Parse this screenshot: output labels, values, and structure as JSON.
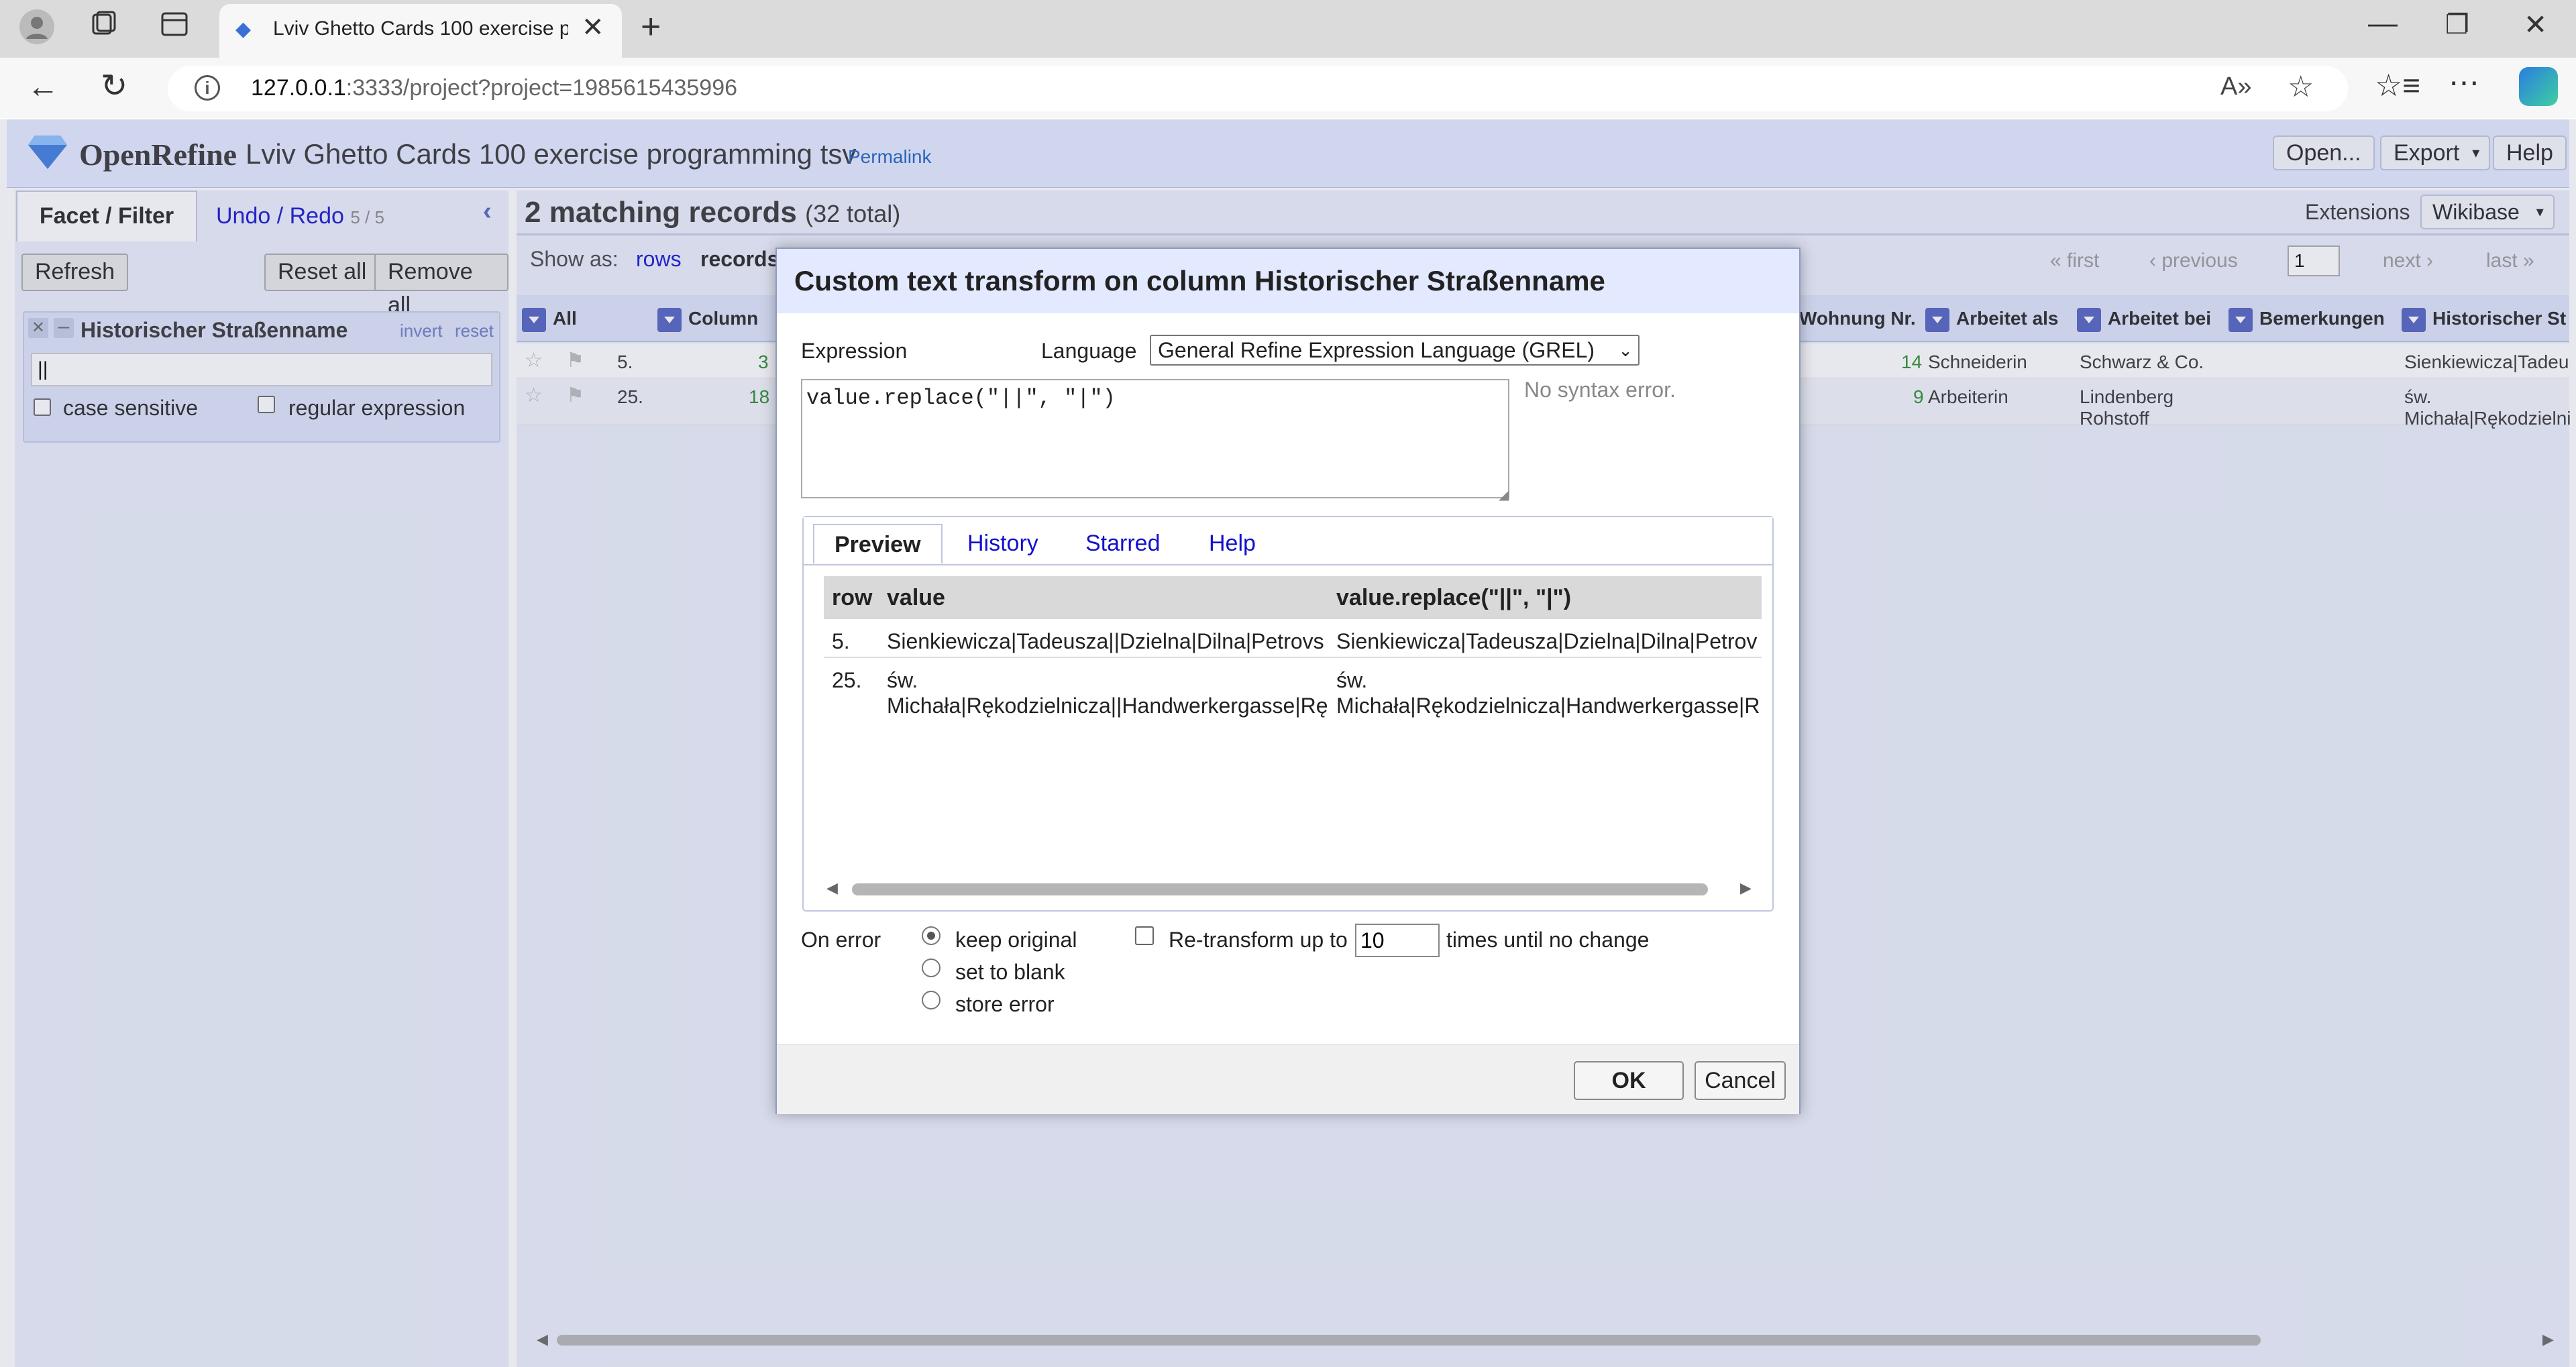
{
  "browser": {
    "tab_title": "Lviv Ghetto Cards 100 exercise pr",
    "url_host": "127.0.0.1",
    "url_rest": ":3333/project?project=1985615435996"
  },
  "app": {
    "logo_text": "OpenRefine",
    "project_name": "Lviv Ghetto Cards 100 exercise programming tsv",
    "permalink": "Permalink",
    "open_btn": "Open...",
    "export_btn": "Export",
    "help_btn": "Help"
  },
  "left_panel": {
    "tab_facet": "Facet / Filter",
    "tab_undo": "Undo / Redo",
    "undo_count": "5 / 5",
    "refresh": "Refresh",
    "reset_all": "Reset all",
    "remove_all": "Remove all",
    "facet_title": "Historischer Straßenname",
    "facet_invert": "invert",
    "facet_reset": "reset",
    "facet_input_value": "||",
    "case_sensitive": "case sensitive",
    "regular_expression": "regular expression"
  },
  "right_panel": {
    "matching": "2 matching records",
    "total": "(32 total)",
    "extensions": "Extensions",
    "wikibase": "Wikibase",
    "show_as": "Show as:",
    "rows": "rows",
    "records": "records",
    "first": "« first",
    "previous": "‹ previous",
    "page": "1",
    "next": "next ›",
    "last": "last »",
    "columns": [
      "All",
      "Column",
      "Wohnung Nr.",
      "Arbeitet als",
      "Arbeitet bei",
      "Bemerkungen",
      "Historischer St"
    ],
    "rows_data": [
      {
        "idx": "5.",
        "col": "3",
        "wohnung": "14",
        "arbeitet_als": "Schneiderin",
        "arbeitet_bei": "Schwarz & Co.",
        "arbeitet_bei2": "",
        "hist": "Sienkiewicza|Tadeu",
        "hist2": ""
      },
      {
        "idx": "25.",
        "col": "18",
        "wohnung": "9",
        "arbeitet_als": "Arbeiterin",
        "arbeitet_bei": "Lindenberg",
        "arbeitet_bei2": "Rohstoff",
        "hist": "św.",
        "hist2": "Michała|Rękodzielni"
      }
    ]
  },
  "dialog": {
    "title": "Custom text transform on column Historischer Straßenname",
    "expression_label": "Expression",
    "language_label": "Language",
    "language_value": "General Refine Expression Language (GREL)",
    "expression": "value.replace(\"||\", \"|\")",
    "syntax_status": "No syntax error.",
    "tabs": [
      "Preview",
      "History",
      "Starred",
      "Help"
    ],
    "preview_headers": [
      "row",
      "value",
      "value.replace(\"||\", \"|\")"
    ],
    "preview_rows": [
      {
        "row": "5.",
        "value": "Sienkiewicza|Tadeusza||Dzielna|Dilna|Petrovs",
        "result": "Sienkiewicza|Tadeusza|Dzielna|Dilna|Petrov"
      },
      {
        "row": "25.",
        "value": "św.\nMichała|Rękodzielnicza||Handwerkergasse|Rę",
        "result": "św.\nMichała|Rękodzielnicza|Handwerkergasse|R"
      }
    ],
    "on_error": "On error",
    "keep_original": "keep original",
    "set_to_blank": "set to blank",
    "store_error": "store error",
    "retransform": "Re-transform up to",
    "retransform_value": "10",
    "times_until": "times until no change",
    "ok": "OK",
    "cancel": "Cancel"
  }
}
